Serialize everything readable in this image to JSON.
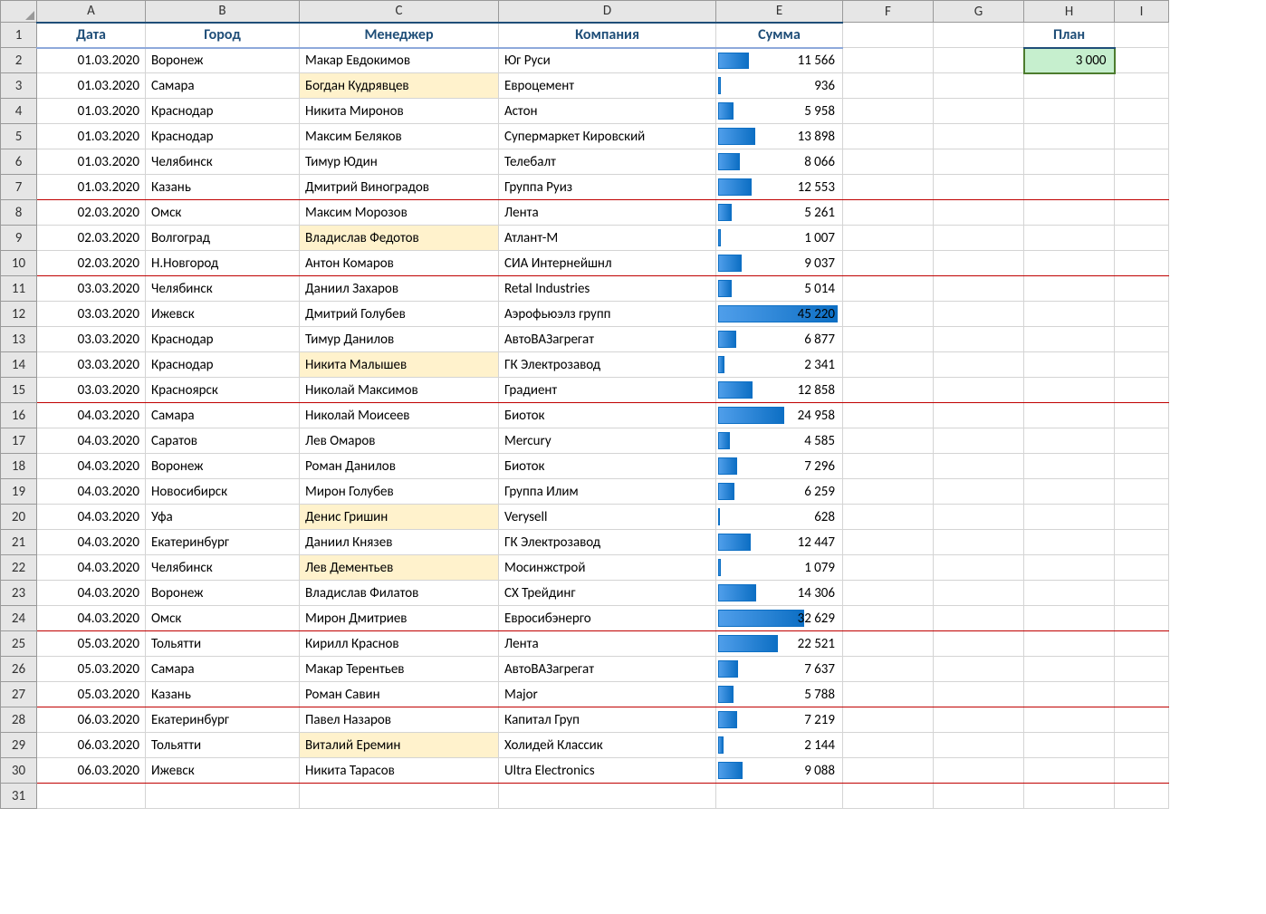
{
  "columns": [
    "A",
    "B",
    "C",
    "D",
    "E",
    "F",
    "G",
    "H",
    "I"
  ],
  "headers": {
    "A": "Дата",
    "B": "Город",
    "C": "Менеджер",
    "D": "Компания",
    "E": "Сумма",
    "H": "План"
  },
  "plan_value": "3 000",
  "max_value": 45220,
  "rows": [
    {
      "n": 2,
      "date": "01.03.2020",
      "city": "Воронеж",
      "manager": "Макар Евдокимов",
      "company": "Юг Руси",
      "sum": 11566,
      "sum_txt": "11 566",
      "hl": false,
      "end": false
    },
    {
      "n": 3,
      "date": "01.03.2020",
      "city": "Самара",
      "manager": "Богдан Кудрявцев",
      "company": "Евроцемент",
      "sum": 936,
      "sum_txt": "936",
      "hl": true,
      "end": false
    },
    {
      "n": 4,
      "date": "01.03.2020",
      "city": "Краснодар",
      "manager": "Никита Миронов",
      "company": "Астон",
      "sum": 5958,
      "sum_txt": "5 958",
      "hl": false,
      "end": false
    },
    {
      "n": 5,
      "date": "01.03.2020",
      "city": "Краснодар",
      "manager": "Максим Беляков",
      "company": "Супермаркет Кировский",
      "sum": 13898,
      "sum_txt": "13 898",
      "hl": false,
      "end": false
    },
    {
      "n": 6,
      "date": "01.03.2020",
      "city": "Челябинск",
      "manager": "Тимур Юдин",
      "company": "Телебалт",
      "sum": 8066,
      "sum_txt": "8 066",
      "hl": false,
      "end": false
    },
    {
      "n": 7,
      "date": "01.03.2020",
      "city": "Казань",
      "manager": "Дмитрий Виноградов",
      "company": "Группа Руиз",
      "sum": 12553,
      "sum_txt": "12 553",
      "hl": false,
      "end": true
    },
    {
      "n": 8,
      "date": "02.03.2020",
      "city": "Омск",
      "manager": "Максим Морозов",
      "company": "Лента",
      "sum": 5261,
      "sum_txt": "5 261",
      "hl": false,
      "end": false
    },
    {
      "n": 9,
      "date": "02.03.2020",
      "city": "Волгоград",
      "manager": "Владислав Федотов",
      "company": "Атлант-М",
      "sum": 1007,
      "sum_txt": "1 007",
      "hl": true,
      "end": false
    },
    {
      "n": 10,
      "date": "02.03.2020",
      "city": "Н.Новгород",
      "manager": "Антон Комаров",
      "company": "СИА Интернейшнл",
      "sum": 9037,
      "sum_txt": "9 037",
      "hl": false,
      "end": true
    },
    {
      "n": 11,
      "date": "03.03.2020",
      "city": "Челябинск",
      "manager": "Даниил Захаров",
      "company": "Retal Industries",
      "sum": 5014,
      "sum_txt": "5 014",
      "hl": false,
      "end": false
    },
    {
      "n": 12,
      "date": "03.03.2020",
      "city": "Ижевск",
      "manager": "Дмитрий Голубев",
      "company": "Аэрофьюэлз групп",
      "sum": 45220,
      "sum_txt": "45 220",
      "hl": false,
      "end": false
    },
    {
      "n": 13,
      "date": "03.03.2020",
      "city": "Краснодар",
      "manager": "Тимур Данилов",
      "company": "АвтоВАЗагрегат",
      "sum": 6877,
      "sum_txt": "6 877",
      "hl": false,
      "end": false
    },
    {
      "n": 14,
      "date": "03.03.2020",
      "city": "Краснодар",
      "manager": "Никита Малышев",
      "company": "ГК Электрозавод",
      "sum": 2341,
      "sum_txt": "2 341",
      "hl": true,
      "end": false
    },
    {
      "n": 15,
      "date": "03.03.2020",
      "city": "Красноярск",
      "manager": "Николай Максимов",
      "company": "Градиент",
      "sum": 12858,
      "sum_txt": "12 858",
      "hl": false,
      "end": true
    },
    {
      "n": 16,
      "date": "04.03.2020",
      "city": "Самара",
      "manager": "Николай Моисеев",
      "company": "Биоток",
      "sum": 24958,
      "sum_txt": "24 958",
      "hl": false,
      "end": false
    },
    {
      "n": 17,
      "date": "04.03.2020",
      "city": "Саратов",
      "manager": "Лев Омаров",
      "company": "Mercury",
      "sum": 4585,
      "sum_txt": "4 585",
      "hl": false,
      "end": false
    },
    {
      "n": 18,
      "date": "04.03.2020",
      "city": "Воронеж",
      "manager": "Роман Данилов",
      "company": "Биоток",
      "sum": 7296,
      "sum_txt": "7 296",
      "hl": false,
      "end": false
    },
    {
      "n": 19,
      "date": "04.03.2020",
      "city": "Новосибирск",
      "manager": "Мирон Голубев",
      "company": "Группа Илим",
      "sum": 6259,
      "sum_txt": "6 259",
      "hl": false,
      "end": false
    },
    {
      "n": 20,
      "date": "04.03.2020",
      "city": "Уфа",
      "manager": "Денис Гришин",
      "company": "Verysell",
      "sum": 628,
      "sum_txt": "628",
      "hl": true,
      "end": false
    },
    {
      "n": 21,
      "date": "04.03.2020",
      "city": "Екатеринбург",
      "manager": "Даниил Князев",
      "company": "ГК Электрозавод",
      "sum": 12447,
      "sum_txt": "12 447",
      "hl": false,
      "end": false
    },
    {
      "n": 22,
      "date": "04.03.2020",
      "city": "Челябинск",
      "manager": "Лев Дементьев",
      "company": "Мосинжстрой",
      "sum": 1079,
      "sum_txt": "1 079",
      "hl": true,
      "end": false
    },
    {
      "n": 23,
      "date": "04.03.2020",
      "city": "Воронеж",
      "manager": "Владислав Филатов",
      "company": "СХ Трейдинг",
      "sum": 14306,
      "sum_txt": "14 306",
      "hl": false,
      "end": false
    },
    {
      "n": 24,
      "date": "04.03.2020",
      "city": "Омск",
      "manager": "Мирон Дмитриев",
      "company": "Евросибэнерго",
      "sum": 32629,
      "sum_txt": "32 629",
      "hl": false,
      "end": true
    },
    {
      "n": 25,
      "date": "05.03.2020",
      "city": "Тольятти",
      "manager": "Кирилл Краснов",
      "company": "Лента",
      "sum": 22521,
      "sum_txt": "22 521",
      "hl": false,
      "end": false
    },
    {
      "n": 26,
      "date": "05.03.2020",
      "city": "Самара",
      "manager": "Макар Терентьев",
      "company": "АвтоВАЗагрегат",
      "sum": 7637,
      "sum_txt": "7 637",
      "hl": false,
      "end": false
    },
    {
      "n": 27,
      "date": "05.03.2020",
      "city": "Казань",
      "manager": "Роман Савин",
      "company": "Major",
      "sum": 5788,
      "sum_txt": "5 788",
      "hl": false,
      "end": true
    },
    {
      "n": 28,
      "date": "06.03.2020",
      "city": "Екатеринбург",
      "manager": "Павел Назаров",
      "company": "Капитал Груп",
      "sum": 7219,
      "sum_txt": "7 219",
      "hl": false,
      "end": false
    },
    {
      "n": 29,
      "date": "06.03.2020",
      "city": "Тольятти",
      "manager": "Виталий Еремин",
      "company": "Холидей Классик",
      "sum": 2144,
      "sum_txt": "2 144",
      "hl": true,
      "end": false
    },
    {
      "n": 30,
      "date": "06.03.2020",
      "city": "Ижевск",
      "manager": "Никита Тарасов",
      "company": "Ultra Electronics",
      "sum": 9088,
      "sum_txt": "9 088",
      "hl": false,
      "end": true
    }
  ],
  "empty_rows": [
    31
  ]
}
